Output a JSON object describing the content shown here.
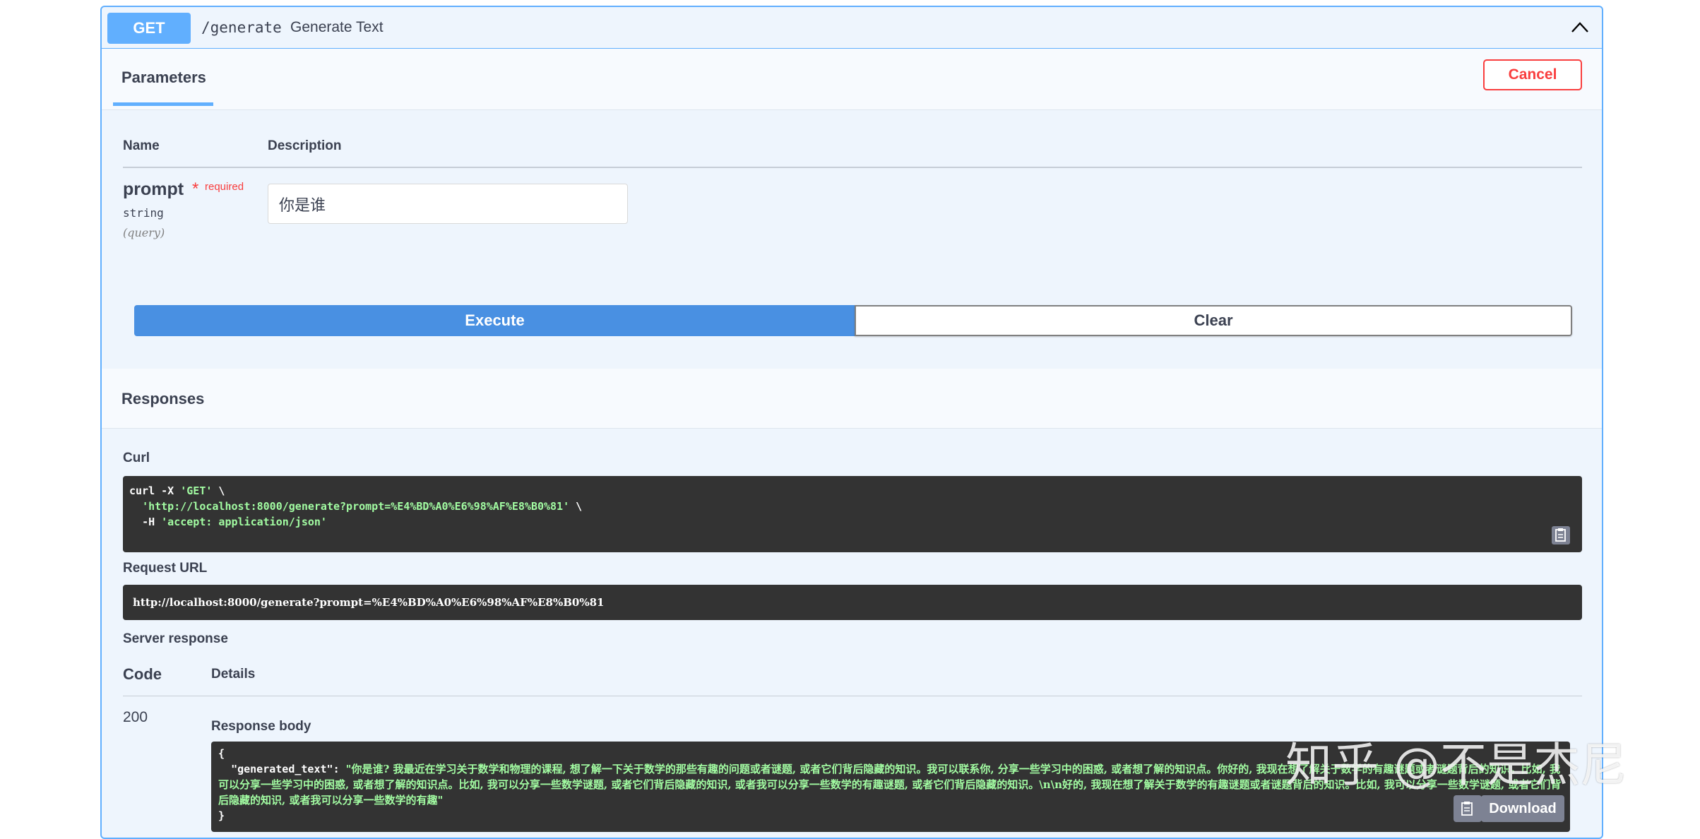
{
  "operation": {
    "method": "GET",
    "path": "/generate",
    "summary": "Generate Text"
  },
  "parameters_section": {
    "tab_label": "Parameters",
    "cancel_label": "Cancel",
    "col_name": "Name",
    "col_description": "Description",
    "param": {
      "name": "prompt",
      "required_star": "*",
      "required_label": "required",
      "type": "string",
      "location": "(query)",
      "value": "你是谁"
    }
  },
  "actions": {
    "execute_label": "Execute",
    "clear_label": "Clear"
  },
  "responses": {
    "title": "Responses",
    "curl_label": "Curl",
    "curl_line1_cmd": "curl -X ",
    "curl_line1_method": "'GET'",
    "curl_line1_cont": " \\",
    "curl_line2_url": "'http://localhost:8000/generate?prompt=%E4%BD%A0%E6%98%AF%E8%B0%81'",
    "curl_line2_cont": " \\",
    "curl_line3_flag": "-H ",
    "curl_line3_header": "'accept: application/json'",
    "request_url_label": "Request URL",
    "request_url": "http://localhost:8000/generate?prompt=%E4%BD%A0%E6%98%AF%E8%B0%81",
    "server_response_label": "Server response",
    "code_header": "Code",
    "details_header": "Details",
    "code": "200",
    "response_body_label": "Response body",
    "body_open": "{",
    "body_key": "\"generated_text\"",
    "body_colon": ": ",
    "body_value": "\"你是谁? 我最近在学习关于数学和物理的课程, 想了解一下关于数学的那些有趣的问题或者谜题, 或者它们背后隐藏的知识。我可以联系你, 分享一些学习中的困惑, 或者想了解的知识点。你好的, 我现在想了解关于数学的有趣谜题或者谜题背后的知识。比如, 我可以分享一些学习中的困惑, 或者想了解的知识点。比如, 我可以分享一些数学谜题, 或者它们背后隐藏的知识, 或者我可以分享一些数学的有趣谜题, 或者它们背后隐藏的知识。\\n\\n好的, 我现在想了解关于数学的有趣谜题或者谜题背后的知识。比如, 我可以分享一些数学谜题, 或者它们背后隐藏的知识, 或者我可以分享一些数学的有趣\"",
    "body_close": "}",
    "download_label": "Download"
  },
  "watermark": "知乎 @不是杰尼",
  "colors": {
    "get_blue": "#61affe",
    "execute_blue": "#4990e2",
    "cancel_red": "#f93e3e",
    "code_bg": "#333333",
    "code_string_green": "#a2fca2"
  }
}
